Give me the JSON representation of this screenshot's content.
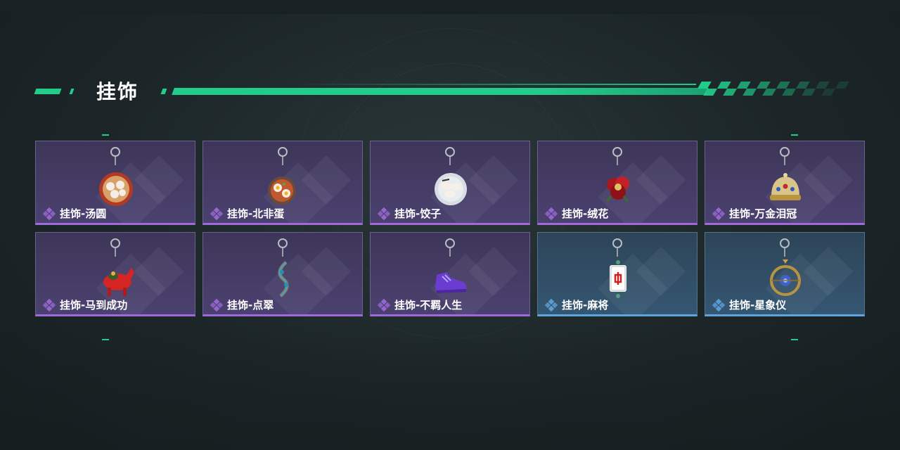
{
  "header": {
    "title": "挂饰"
  },
  "colors": {
    "accent": "#22cc8a",
    "purple_rarity": "#9f6ad8",
    "blue_rarity": "#5ea5e0"
  },
  "items": [
    {
      "label": "挂饰-汤圆",
      "rarity": "purple",
      "icon": "tangyuan-bowl-icon"
    },
    {
      "label": "挂饰-北非蛋",
      "rarity": "purple",
      "icon": "shakshuka-pan-icon"
    },
    {
      "label": "挂饰-饺子",
      "rarity": "purple",
      "icon": "dumpling-plate-icon"
    },
    {
      "label": "挂饰-绒花",
      "rarity": "purple",
      "icon": "velvet-flower-icon"
    },
    {
      "label": "挂饰-万金泪冠",
      "rarity": "purple",
      "icon": "jeweled-crown-icon"
    },
    {
      "label": "挂饰-马到成功",
      "rarity": "purple",
      "icon": "red-horse-icon"
    },
    {
      "label": "挂饰-点翠",
      "rarity": "purple",
      "icon": "kingfisher-hairpin-icon"
    },
    {
      "label": "挂饰-不羁人生",
      "rarity": "purple",
      "icon": "sneaker-icon"
    },
    {
      "label": "挂饰-麻将",
      "rarity": "blue",
      "icon": "mahjong-tile-icon"
    },
    {
      "label": "挂饰-星象仪",
      "rarity": "blue",
      "icon": "astrolabe-icon"
    }
  ]
}
